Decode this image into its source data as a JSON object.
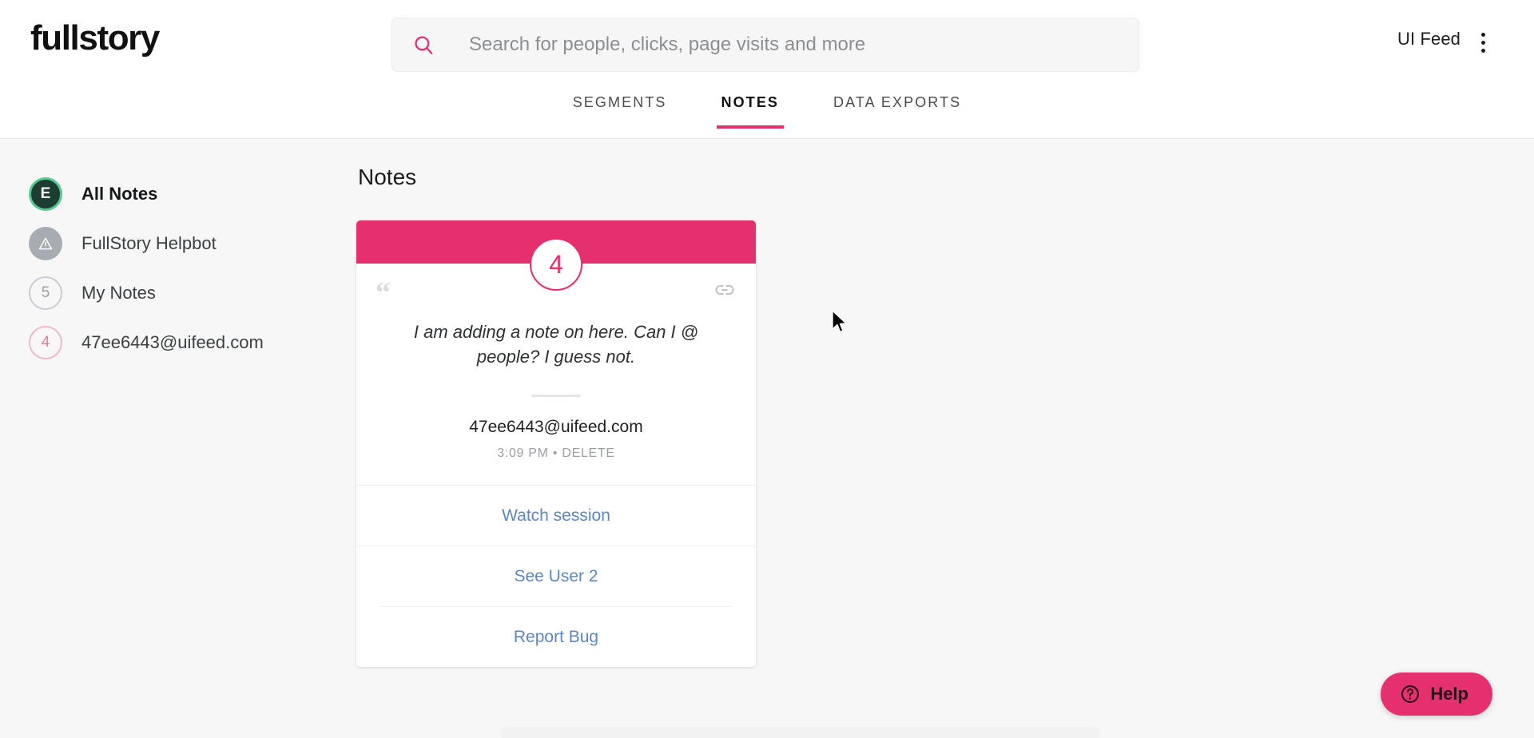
{
  "brand": {
    "logo_text": "fullstory",
    "accent_pink": "#e5306f",
    "link_blue": "#5c87c7",
    "green_avatar": "#55c98f"
  },
  "header": {
    "account_name": "UI Feed",
    "kebab_icon": "more-vertical-icon"
  },
  "search": {
    "icon": "search-icon",
    "placeholder": "Search for people, clicks, page visits and more",
    "value": ""
  },
  "tabs": [
    {
      "label": "SEGMENTS",
      "active": false
    },
    {
      "label": "NOTES",
      "active": true
    },
    {
      "label": "DATA EXPORTS",
      "active": false
    }
  ],
  "sidebar": {
    "items": [
      {
        "label": "All Notes",
        "badge": "E",
        "badge_style": "green-filled",
        "active": true
      },
      {
        "label": "FullStory Helpbot",
        "badge": "warning-triangle-icon",
        "badge_style": "gray-filled",
        "active": false
      },
      {
        "label": "My Notes",
        "badge": "5",
        "badge_style": "gray-outline",
        "active": false
      },
      {
        "label": "47ee6443@uifeed.com",
        "badge": "4",
        "badge_style": "pink-outline",
        "active": false
      }
    ]
  },
  "main": {
    "title": "Notes",
    "note_card": {
      "count": "4",
      "quote_icon": "quote-icon",
      "link_icon": "link-icon",
      "text": "I am adding a note on here. Can I @ people? I guess not.",
      "author": "47ee6443@uifeed.com",
      "time": "3:09 PM",
      "separator": "•",
      "delete_label": "DELETE",
      "actions": [
        {
          "label": "Watch session"
        },
        {
          "label": "See User 2"
        },
        {
          "label": "Report Bug"
        }
      ]
    }
  },
  "help_widget": {
    "icon": "question-circle-icon",
    "label": "Help"
  }
}
